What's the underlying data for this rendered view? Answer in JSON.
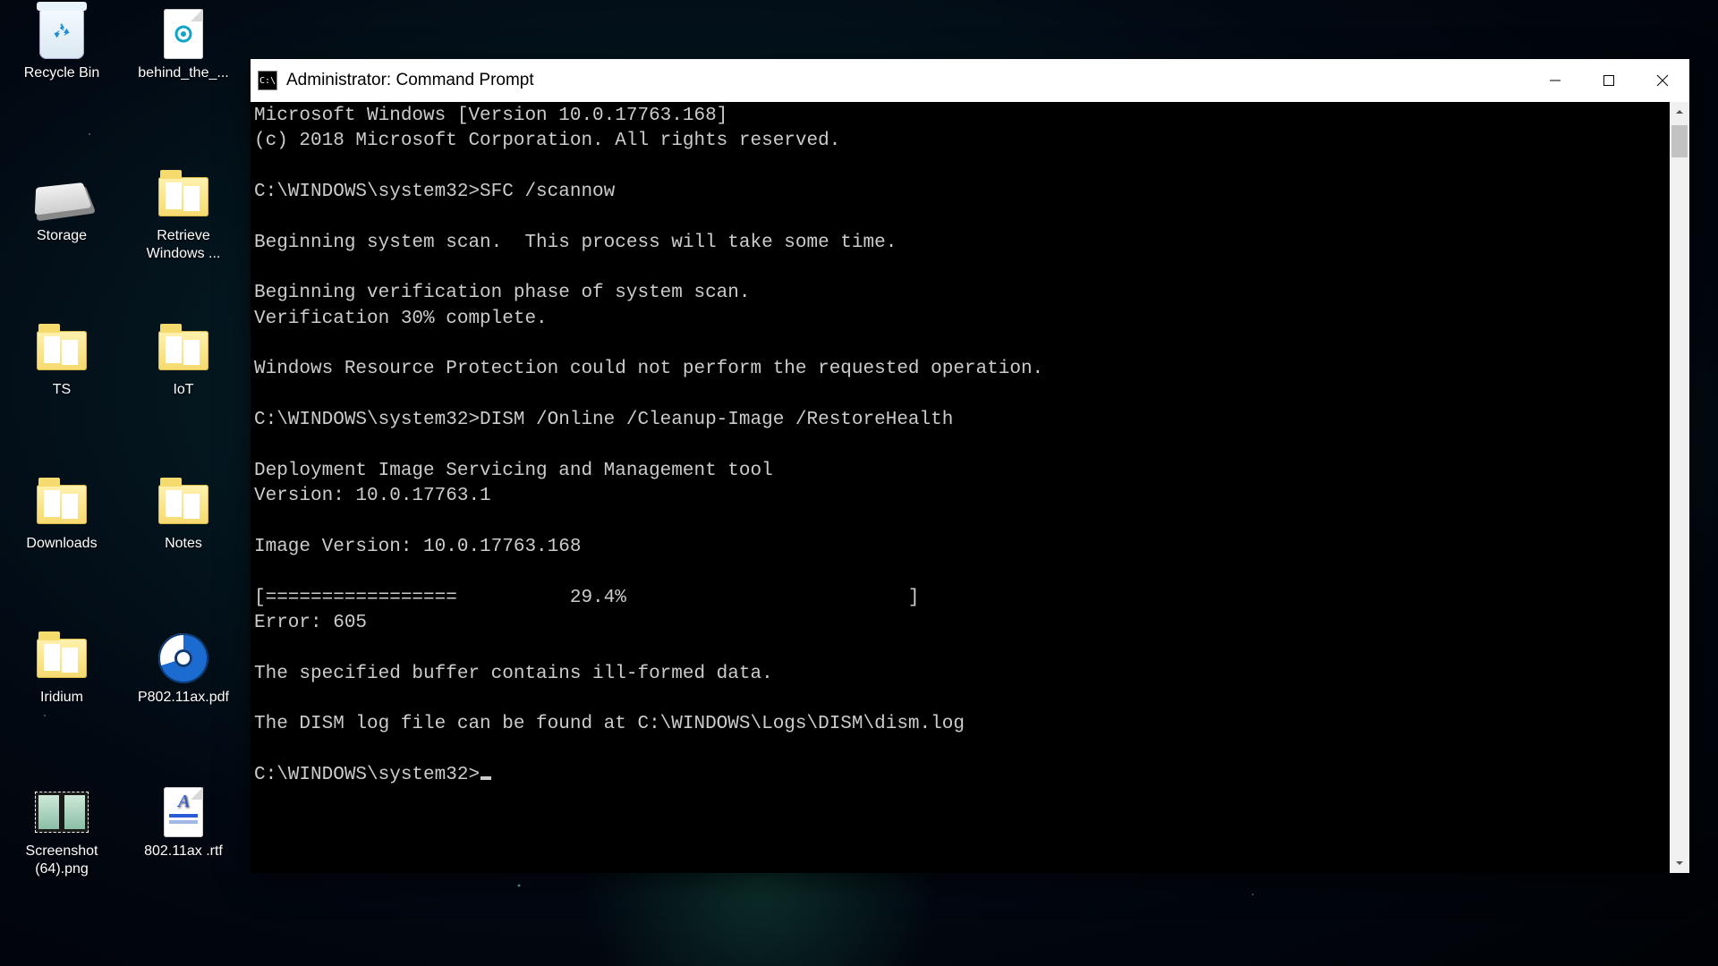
{
  "desktop": {
    "icons": [
      {
        "label": "Recycle Bin"
      },
      {
        "label": "behind_the_..."
      },
      {
        "label": "Storage"
      },
      {
        "label": "Retrieve Windows ..."
      },
      {
        "label": "TS"
      },
      {
        "label": "IoT"
      },
      {
        "label": "Downloads"
      },
      {
        "label": "Notes"
      },
      {
        "label": "Iridium"
      },
      {
        "label": "P802.11ax.pdf"
      },
      {
        "label": "Screenshot (64).png"
      },
      {
        "label": "802.11ax .rtf"
      }
    ]
  },
  "window": {
    "title": "Administrator: Command Prompt",
    "icon_text": "C:\\",
    "terminal_lines": [
      "Microsoft Windows [Version 10.0.17763.168]",
      "(c) 2018 Microsoft Corporation. All rights reserved.",
      "",
      "C:\\WINDOWS\\system32>SFC /scannow",
      "",
      "Beginning system scan.  This process will take some time.",
      "",
      "Beginning verification phase of system scan.",
      "Verification 30% complete.",
      "",
      "Windows Resource Protection could not perform the requested operation.",
      "",
      "C:\\WINDOWS\\system32>DISM /Online /Cleanup-Image /RestoreHealth",
      "",
      "Deployment Image Servicing and Management tool",
      "Version: 10.0.17763.1",
      "",
      "Image Version: 10.0.17763.168",
      "",
      "[=================          29.4%                         ]",
      "Error: 605",
      "",
      "The specified buffer contains ill-formed data.",
      "",
      "The DISM log file can be found at C:\\WINDOWS\\Logs\\DISM\\dism.log",
      "",
      "C:\\WINDOWS\\system32>"
    ]
  }
}
